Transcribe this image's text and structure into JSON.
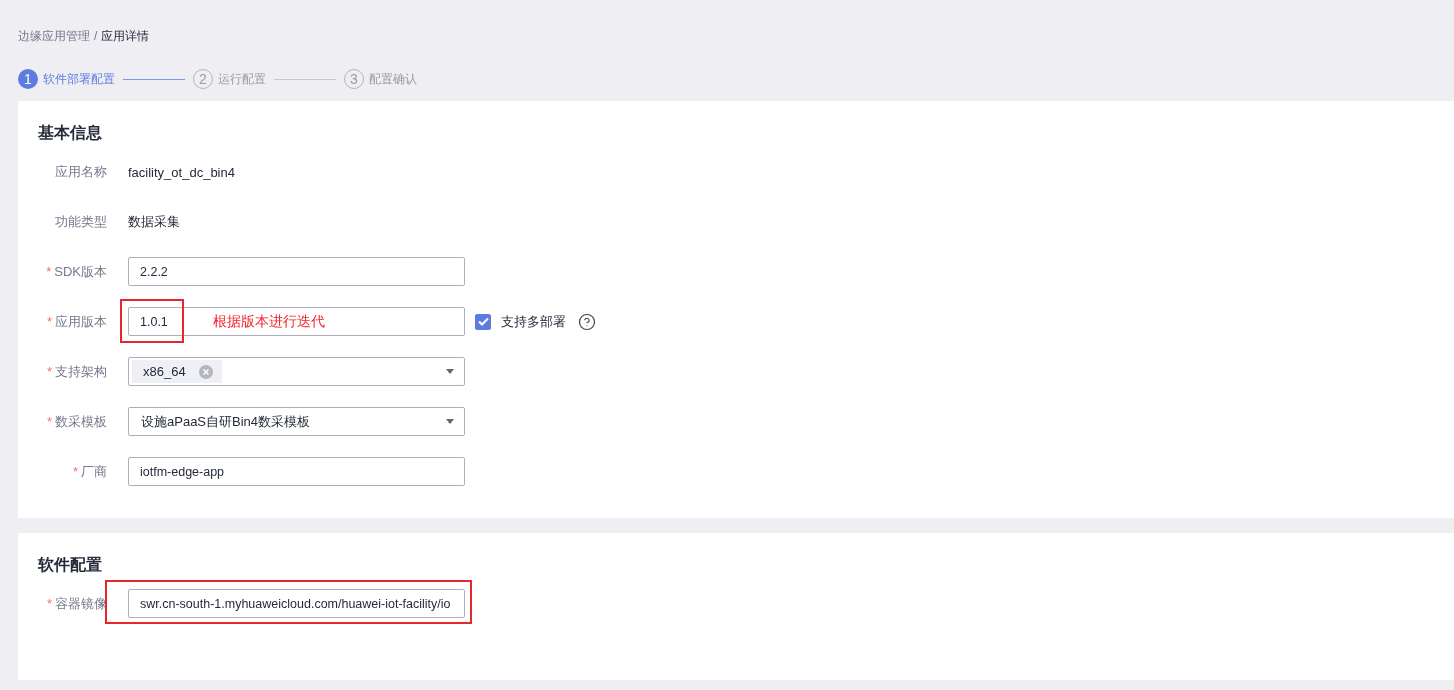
{
  "breadcrumb": [
    {
      "label": "边缘应用管理",
      "current": false
    },
    {
      "label": "/",
      "current": false
    },
    {
      "label": "应用详情",
      "current": true
    }
  ],
  "steps": [
    {
      "number": "1",
      "label": "软件部署配置",
      "selected": true
    },
    {
      "number": "2",
      "label": "运行配置",
      "selected": false
    },
    {
      "number": "3",
      "label": "配置确认",
      "selected": false
    }
  ],
  "sections": [
    {
      "title": "基本信息",
      "fields": [
        {
          "kind": "text",
          "label": "应用名称",
          "value": "facility_ot_dc_bin4"
        },
        {
          "kind": "text",
          "label": "功能类型",
          "value": "数据采集"
        },
        {
          "kind": "input",
          "mark": "*",
          "label": "SDK版本",
          "value": "2.2.2"
        },
        {
          "kind": "input",
          "mark": "*",
          "label": "应用版本",
          "value": "1.0.1",
          "highlight_value": true,
          "note": "根据版本进行迭代",
          "checkbox": {
            "label": "支持多部署",
            "checked": true
          },
          "help": true
        },
        {
          "kind": "tags",
          "mark": "*",
          "label": "支持架构",
          "tags": [
            "x86_64"
          ]
        },
        {
          "kind": "select",
          "mark": "*",
          "label": "数采模板",
          "value": "设施aPaaS自研Bin4数采模板"
        },
        {
          "kind": "input",
          "mark": "*",
          "label": "厂商",
          "value": "iotfm-edge-app"
        }
      ]
    },
    {
      "title": "软件配置",
      "fields": [
        {
          "kind": "input",
          "mark": "*",
          "label": "容器镜像",
          "value": "swr.cn-south-1.myhuaweicloud.com/huawei-iot-facility/io",
          "highlight_row": true
        }
      ]
    }
  ]
}
